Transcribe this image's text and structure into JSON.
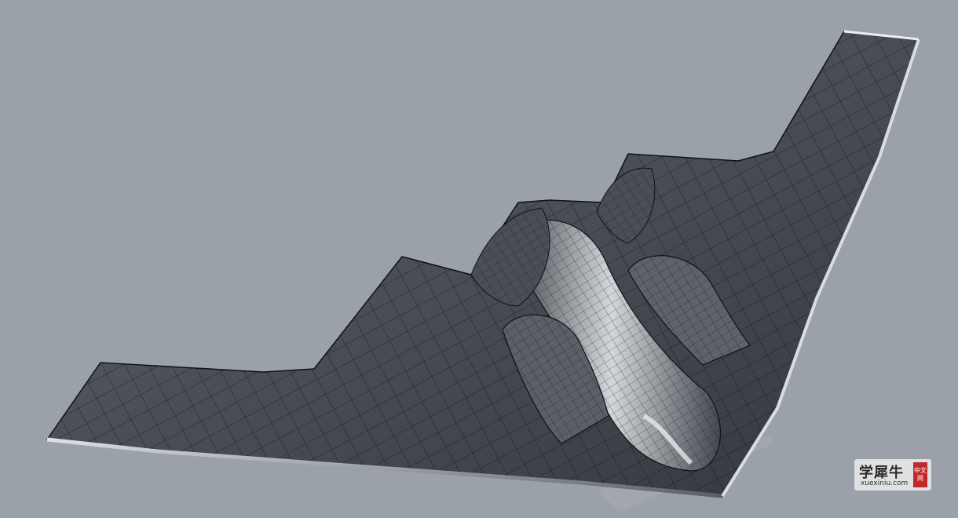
{
  "scene": {
    "background": "#9ba1a9",
    "model": "stealth-bomber-wireframe-surface",
    "surface_colors": [
      "#3a3d44",
      "#6b6f78",
      "#c8ccd2"
    ]
  },
  "watermark": {
    "chinese": "学犀牛",
    "badge": "中文网",
    "url": "xuexiniu.com"
  }
}
